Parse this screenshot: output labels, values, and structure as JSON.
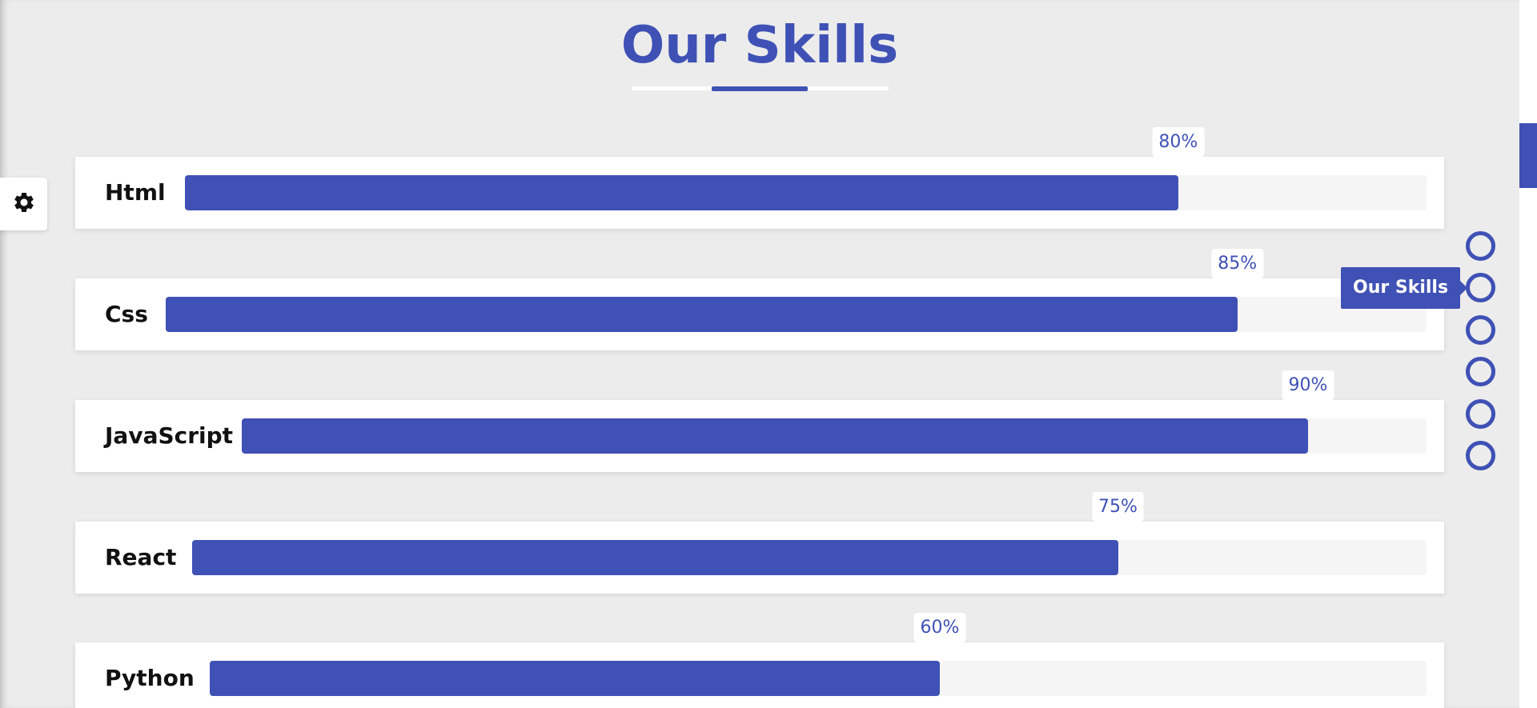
{
  "section": {
    "title": "Our Skills"
  },
  "skills": [
    {
      "name": "Html",
      "percent": 80,
      "label": "80%"
    },
    {
      "name": "Css",
      "percent": 85,
      "label": "85%"
    },
    {
      "name": "JavaScript",
      "percent": 90,
      "label": "90%"
    },
    {
      "name": "React",
      "percent": 75,
      "label": "75%"
    },
    {
      "name": "Python",
      "percent": 60,
      "label": "60%"
    }
  ],
  "nav_bullets": {
    "count": 6,
    "active_index": 1,
    "tooltip": "Our Skills"
  },
  "icons": {
    "settings": "gear-icon"
  },
  "colors": {
    "accent": "#3f51b5",
    "background": "#ececec",
    "track": "#f5f5f5"
  },
  "scroll": {
    "position": 0.2
  }
}
